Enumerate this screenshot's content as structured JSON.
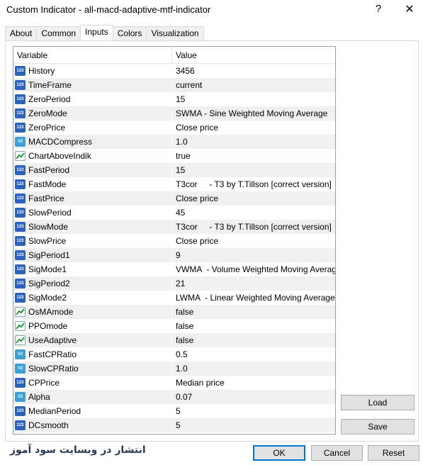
{
  "window": {
    "title": "Custom Indicator - all-macd-adaptive-mtf-indicator",
    "help_glyph": "?",
    "close_glyph": "✕"
  },
  "tabs": [
    {
      "label": "About"
    },
    {
      "label": "Common"
    },
    {
      "label": "Inputs"
    },
    {
      "label": "Colors"
    },
    {
      "label": "Visualization"
    }
  ],
  "grid": {
    "col_variable": "Variable",
    "col_value": "Value",
    "rows": [
      {
        "name": "History",
        "value": "3456",
        "type": "int"
      },
      {
        "name": "TimeFrame",
        "value": "current",
        "type": "int"
      },
      {
        "name": "ZeroPeriod",
        "value": "15",
        "type": "int"
      },
      {
        "name": "ZeroMode",
        "value": "SWMA - Sine Weighted Moving Average",
        "type": "int"
      },
      {
        "name": "ZeroPrice",
        "value": "Close price",
        "type": "int"
      },
      {
        "name": "MACDCompress",
        "value": "1.0",
        "type": "double"
      },
      {
        "name": "ChartAboveIndik",
        "value": "true",
        "type": "bool"
      },
      {
        "name": "FastPeriod",
        "value": "15",
        "type": "int"
      },
      {
        "name": "FastMode",
        "value": "T3cor     - T3 by T.Tillson [correct version]",
        "type": "int"
      },
      {
        "name": "FastPrice",
        "value": "Close price",
        "type": "int"
      },
      {
        "name": "SlowPeriod",
        "value": "45",
        "type": "int"
      },
      {
        "name": "SlowMode",
        "value": "T3cor     - T3 by T.Tillson [correct version]",
        "type": "int"
      },
      {
        "name": "SlowPrice",
        "value": "Close price",
        "type": "int"
      },
      {
        "name": "SigPeriod1",
        "value": "9",
        "type": "int"
      },
      {
        "name": "SigMode1",
        "value": "VWMA  - Volume Weighted Moving Average",
        "type": "int"
      },
      {
        "name": "SigPeriod2",
        "value": "21",
        "type": "int"
      },
      {
        "name": "SigMode2",
        "value": "LWMA  - Linear Weighted Moving Average",
        "type": "int"
      },
      {
        "name": "OsMAmode",
        "value": "false",
        "type": "bool"
      },
      {
        "name": "PPOmode",
        "value": "false",
        "type": "bool"
      },
      {
        "name": "UseAdaptive",
        "value": "false",
        "type": "bool"
      },
      {
        "name": "FastCPRatio",
        "value": "0.5",
        "type": "double"
      },
      {
        "name": "SlowCPRatio",
        "value": "1.0",
        "type": "double"
      },
      {
        "name": "CPPrice",
        "value": "Median price",
        "type": "int"
      },
      {
        "name": "Alpha",
        "value": "0.07",
        "type": "double"
      },
      {
        "name": "MedianPeriod",
        "value": "5",
        "type": "int"
      },
      {
        "name": "DCsmooth",
        "value": "5",
        "type": "int"
      }
    ]
  },
  "buttons": {
    "load": "Load",
    "save": "Save",
    "ok": "OK",
    "cancel": "Cancel",
    "reset": "Reset"
  },
  "watermark": "انتشار در وبسایت سود آموز",
  "icons": {
    "int": "123-icon",
    "double": "v2-icon",
    "bool": "chart-line-icon"
  },
  "colors": {
    "accent": "#0078d7",
    "int_icon": "#2a64c0",
    "double_icon": "#3aa0d8",
    "row_alt": "#f0f0f0"
  }
}
